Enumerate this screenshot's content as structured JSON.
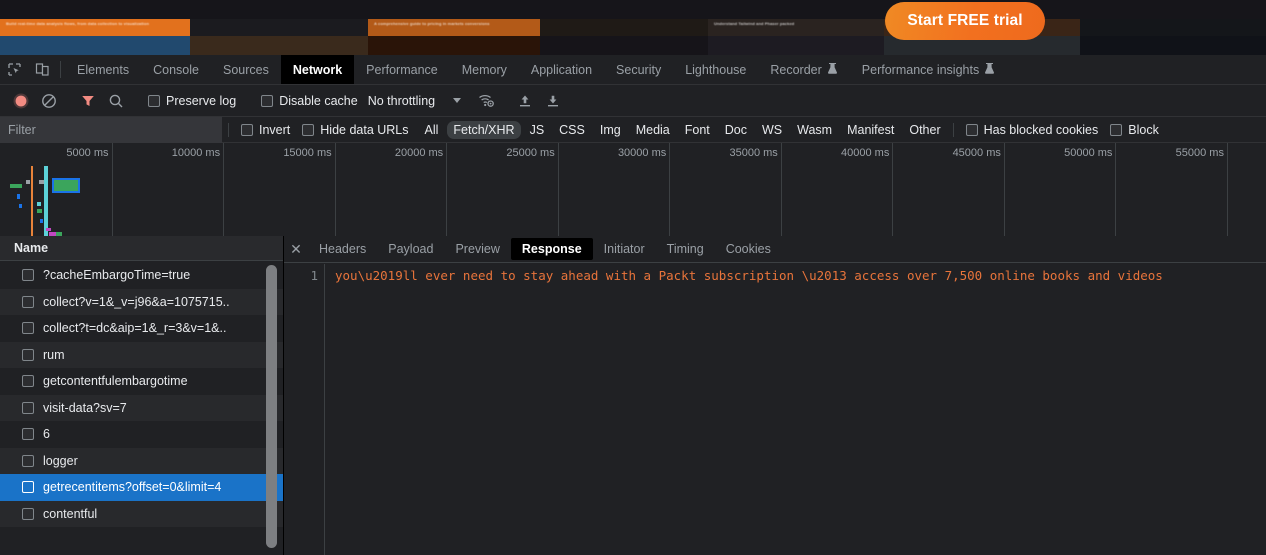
{
  "page": {
    "cta_label": "Start FREE trial",
    "covers": [
      {
        "width": 190,
        "band": "#e2711d",
        "art": "#21496e",
        "text": "Build real-time data analysis flows, from data collection to visualization"
      },
      {
        "width": 178,
        "band": "#1b1b1f",
        "art": "#3a2a1c",
        "text": ""
      },
      {
        "width": 172,
        "band": "#b35a18",
        "art": "#2a1408",
        "text": "A comprehensive guide to pricing in markets conversions"
      },
      {
        "width": 168,
        "band": "#1f1a16",
        "art": "#161419",
        "text": ""
      },
      {
        "width": 176,
        "band": "#2a2320",
        "art": "#1d1b22",
        "text": "Understand Tailwind and Phaser packed"
      },
      {
        "width": 196,
        "band": "#3a2517",
        "art": "#262a2e",
        "text": ""
      },
      {
        "width": 186,
        "band": "#14161a",
        "art": "#101218",
        "text": ""
      }
    ]
  },
  "devtools": {
    "icons": {
      "inspect": "inspect-element-icon",
      "device": "device-toolbar-icon",
      "record": "record-icon",
      "clear": "clear-icon",
      "filter": "filter-icon",
      "search": "search-icon",
      "throttle_settings": "network-conditions-icon",
      "import": "import-har-icon",
      "export": "export-har-icon",
      "close": "close-icon"
    },
    "tabs": [
      {
        "label": "Elements",
        "active": false,
        "flask": false
      },
      {
        "label": "Console",
        "active": false,
        "flask": false
      },
      {
        "label": "Sources",
        "active": false,
        "flask": false
      },
      {
        "label": "Network",
        "active": true,
        "flask": false
      },
      {
        "label": "Performance",
        "active": false,
        "flask": false
      },
      {
        "label": "Memory",
        "active": false,
        "flask": false
      },
      {
        "label": "Application",
        "active": false,
        "flask": false
      },
      {
        "label": "Security",
        "active": false,
        "flask": false
      },
      {
        "label": "Lighthouse",
        "active": false,
        "flask": false
      },
      {
        "label": "Recorder",
        "active": false,
        "flask": true
      },
      {
        "label": "Performance insights",
        "active": false,
        "flask": true
      }
    ],
    "toolbar": {
      "preserve_log_label": "Preserve log",
      "preserve_log_checked": false,
      "disable_cache_label": "Disable cache",
      "disable_cache_checked": false,
      "throttling_value": "No throttling"
    },
    "filterbar": {
      "filter_placeholder": "Filter",
      "filter_value": "",
      "invert_label": "Invert",
      "invert_checked": false,
      "hide_data_urls_label": "Hide data URLs",
      "hide_data_urls_checked": false,
      "types": [
        {
          "label": "All",
          "active": false
        },
        {
          "label": "Fetch/XHR",
          "active": true
        },
        {
          "label": "JS",
          "active": false
        },
        {
          "label": "CSS",
          "active": false
        },
        {
          "label": "Img",
          "active": false
        },
        {
          "label": "Media",
          "active": false
        },
        {
          "label": "Font",
          "active": false
        },
        {
          "label": "Doc",
          "active": false
        },
        {
          "label": "WS",
          "active": false
        },
        {
          "label": "Wasm",
          "active": false
        },
        {
          "label": "Manifest",
          "active": false
        },
        {
          "label": "Other",
          "active": false
        }
      ],
      "has_blocked_cookies_label": "Has blocked cookies",
      "has_blocked_cookies_checked": false,
      "blocked_requests_label": "Block",
      "blocked_requests_checked": false
    },
    "overview": {
      "ticks": [
        "5000 ms",
        "10000 ms",
        "15000 ms",
        "20000 ms",
        "25000 ms",
        "30000 ms",
        "35000 ms",
        "40000 ms",
        "45000 ms",
        "50000 ms",
        "55000 ms"
      ],
      "dom_content_loaded_color": "#e8833a",
      "load_event_color": "#5cd1d8",
      "bar_color": "#3ba55c",
      "highlight_border_color": "#1a73e8"
    },
    "requests": {
      "column_header": "Name",
      "rows": [
        {
          "name": "?cacheEmbargoTime=true",
          "selected": false
        },
        {
          "name": "collect?v=1&_v=j96&a=1075715..",
          "selected": false
        },
        {
          "name": "collect?t=dc&aip=1&_r=3&v=1&..",
          "selected": false
        },
        {
          "name": "rum",
          "selected": false
        },
        {
          "name": "getcontentfulembargotime",
          "selected": false
        },
        {
          "name": "visit-data?sv=7",
          "selected": false
        },
        {
          "name": "6",
          "selected": false
        },
        {
          "name": "logger",
          "selected": false
        },
        {
          "name": "getrecentitems?offset=0&limit=4",
          "selected": true
        },
        {
          "name": "contentful",
          "selected": false
        }
      ]
    },
    "detail": {
      "tabs": [
        {
          "label": "Headers",
          "active": false
        },
        {
          "label": "Payload",
          "active": false
        },
        {
          "label": "Preview",
          "active": false
        },
        {
          "label": "Response",
          "active": true
        },
        {
          "label": "Initiator",
          "active": false
        },
        {
          "label": "Timing",
          "active": false
        },
        {
          "label": "Cookies",
          "active": false
        }
      ],
      "line_number": "1",
      "response_body": "you\\u2019ll ever need to stay ahead with a Packt subscription \\u2013 access over 7,500 online books and videos"
    }
  }
}
